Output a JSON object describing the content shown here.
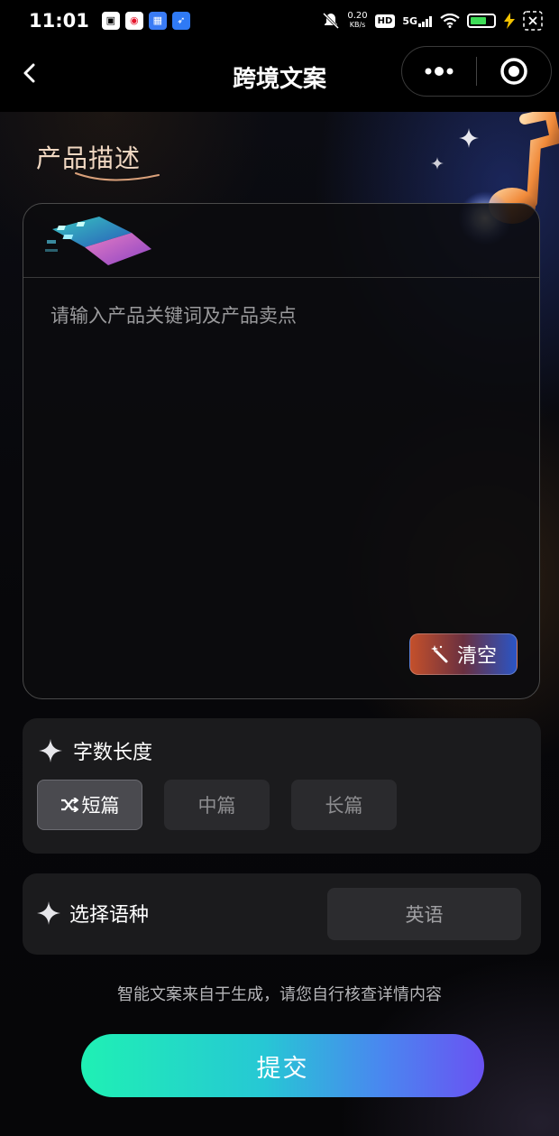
{
  "status_bar": {
    "time": "11:01",
    "net_speed_value": "0.20",
    "net_speed_unit": "KB/s",
    "hd_badge": "HD",
    "signal": "5G",
    "battery_level": 0.75
  },
  "nav": {
    "title": "跨境文案"
  },
  "product": {
    "heading": "产品描述",
    "placeholder": "请输入产品关键词及产品卖点",
    "clear_label": "清空"
  },
  "length": {
    "label": "字数长度",
    "options": [
      {
        "label": "短篇",
        "selected": true
      },
      {
        "label": "中篇",
        "selected": false
      },
      {
        "label": "长篇",
        "selected": false
      }
    ]
  },
  "language": {
    "label": "选择语种",
    "selected": "英语"
  },
  "disclaimer": "智能文案来自于生成，请您自行核查详情内容",
  "submit_label": "提交",
  "colors": {
    "submit_gradient": [
      "#1ff0b4",
      "#4a86f0",
      "#6a52f2"
    ],
    "clear_gradient": [
      "#c4502b",
      "#2a55c6"
    ],
    "heading_color": "#f1d8c2"
  }
}
